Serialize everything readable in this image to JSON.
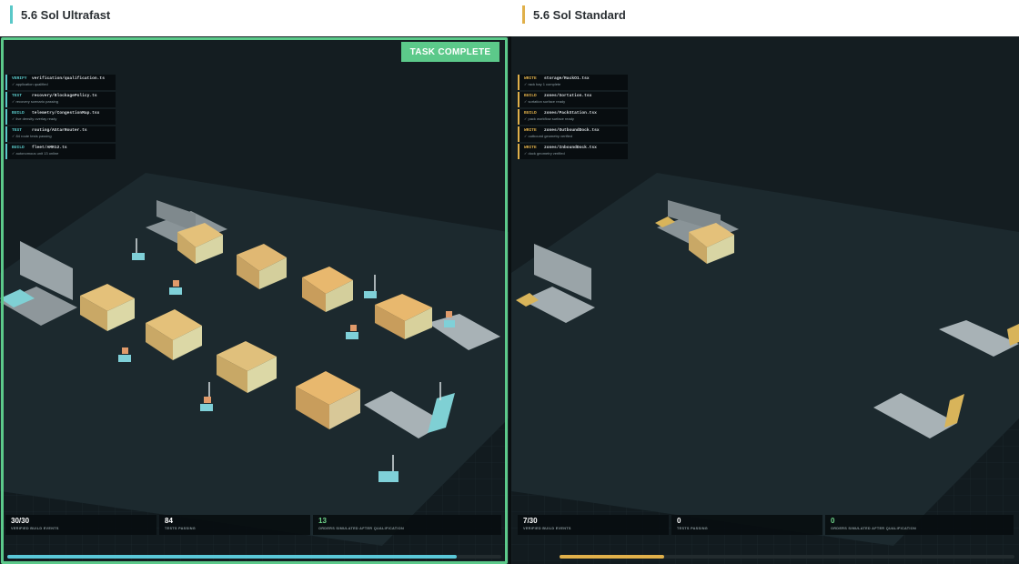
{
  "left": {
    "title": "5.6 Sol Ultrafast",
    "accent": "#5ac8c8",
    "badge": "TASK COMPLETE",
    "logs": [
      {
        "type": "VERIFY",
        "file": "verification/qualification.ts",
        "note": "✓ application qualified",
        "color": "#5ac8c8"
      },
      {
        "type": "TEST",
        "file": "recovery/BlockagePolicy.ts",
        "note": "✓ recovery scenario passing",
        "color": "#5ac8c8"
      },
      {
        "type": "BUILD",
        "file": "telemetry/CongestionMap.tsx",
        "note": "✓ live density overlay ready",
        "color": "#5ac8c8"
      },
      {
        "type": "TEST",
        "file": "routing/AStarRouter.ts",
        "note": "✓ 84 route tests passing",
        "color": "#5ac8c8"
      },
      {
        "type": "BUILD",
        "file": "fleet/AMR12.ts",
        "note": "✓ autonomous unit 13 online",
        "color": "#5ac8c8"
      }
    ],
    "stats": [
      {
        "value": "30/30",
        "label": "VERIFIED BUILD EVENTS",
        "color": "#ffffff"
      },
      {
        "value": "84",
        "label": "TESTS PASSING",
        "color": "#ffffff"
      },
      {
        "value": "13",
        "label": "ORDERS SIMULATED AFTER QUALIFICATION",
        "color": "#6fd48a"
      }
    ],
    "progress": 0.91,
    "progress_color": "#5ac8d8"
  },
  "right": {
    "title": "5.6 Sol Standard",
    "accent": "#e0b04a",
    "logs": [
      {
        "type": "WRITE",
        "file": "storage/RackO1.tsx",
        "note": "✓ rack bay 1 complete",
        "color": "#e0b04a"
      },
      {
        "type": "BUILD",
        "file": "zones/Sortation.tsx",
        "note": "✓ sortation surface ready",
        "color": "#e0b04a"
      },
      {
        "type": "BUILD",
        "file": "zones/PackStation.tsx",
        "note": "✓ pack workflow surface ready",
        "color": "#e0b04a"
      },
      {
        "type": "WRITE",
        "file": "zones/OutboundDock.tsx",
        "note": "✓ outbound geometry verified",
        "color": "#e0b04a"
      },
      {
        "type": "WRITE",
        "file": "zones/InboundDock.tsx",
        "note": "✓ dock geometry verified",
        "color": "#e0b04a"
      }
    ],
    "stats": [
      {
        "value": "7/30",
        "label": "VERIFIED BUILD EVENTS",
        "color": "#ffffff"
      },
      {
        "value": "0",
        "label": "TESTS PASSING",
        "color": "#ffffff"
      },
      {
        "value": "0",
        "label": "ORDERS SIMULATED AFTER QUALIFICATION",
        "color": "#6fd48a"
      }
    ],
    "progress": 0.23,
    "progress_color": "#e0b04a"
  }
}
